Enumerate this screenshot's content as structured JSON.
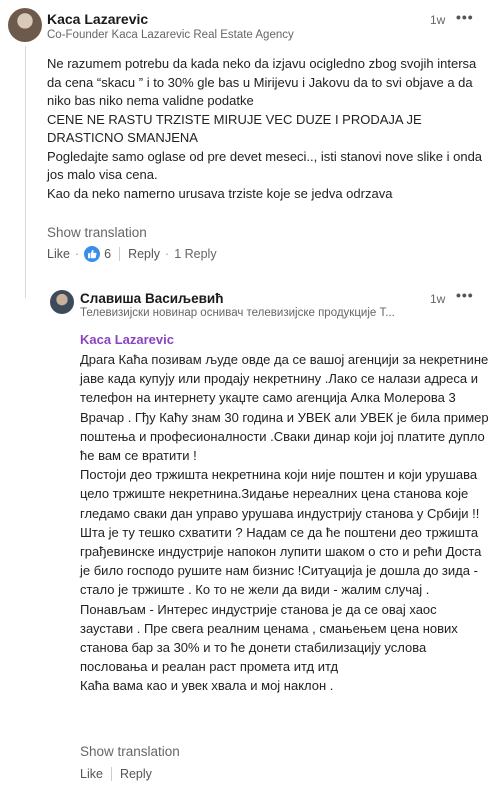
{
  "comment1": {
    "author": "Kaca Lazarevic",
    "headline": "Co-Founder Kaca Lazarevic Real Estate Agency",
    "time": "1w",
    "more": "•••",
    "paragraphs": [
      "Ne razumem potrebu da kada neko da izjavu ocigledno zbog svojih intersa da cena “skacu ” i to 30% gle bas u Mirijevu i Jakovu da to svi objave a da niko bas niko nema validne podatke",
      "CENE NE RASTU TRZISTE MIRUJE VEC DUZE I PRODAJA JE DRASTICNO SMANJENA",
      "Pogledajte samo oglase od pre devet meseci.., isti stanovi nove slike i onda jos malo visa cena.",
      "Kao da neko namerno urusava trziste koje se jedva odrzava"
    ],
    "show_translation": "Show translation",
    "like_label": "Like",
    "dot": "·",
    "reaction_count": "6",
    "reply_label": "Reply",
    "replies_count": "1 Reply"
  },
  "comment2": {
    "author": "Славиша Васиљевић",
    "headline": "Телевизијски новинар оснивач телевизијске продукције Т...",
    "time": "1w",
    "more": "•••",
    "mention": "Kaca Lazarevic",
    "paragraphs": [
      "Драга Каћа позивам људе овде да се вашој агенцији за некретнине јаве када купују или продају некретнину .Лако се налази адреса и телефон на интернету укаџте само агенција Алка Молерова 3 Врачар . Гђу Каћу знам 30 година и УВЕК али УВЕК је била пример поштења и професионалности .Сваки динар који јој платите дупло ће вам се вратити !",
      "Постоји део тржишта некретнина који није поштен и који урушава цело тржиште некретнина.Зидање нереалних цена станова које гледамо сваки дан управо урушава индустрију станова у Србији !!Шта је ту тешко схватити ? Надам се да ће поштени део тржишта грађевинске индустрије напокон лупити шаком о сто и рећи Доста је било господо рушите нам бизнис !Ситуација је дошла до зида - стало је тржиште . Ко то не жели да види - жалим случај . Понављам - Интерес индустрије станова је да се овај хаос заустави . Пре свега реалним ценама , смањењем цена нових станова бар за 30% и то ће донети стабилизацију услова пословања и реалан раст промета итд итд",
      "Каћа вама као и увек хвала и мој наклон ."
    ],
    "show_translation": "Show translation",
    "like_label": "Like",
    "reply_label": "Reply"
  },
  "colors": {
    "mention": "#8a44c2",
    "like_reaction": "#378fe9",
    "muted_text": "#666666"
  },
  "icons": {
    "reaction": "thumbs-up-icon",
    "more": "more-options-icon"
  }
}
